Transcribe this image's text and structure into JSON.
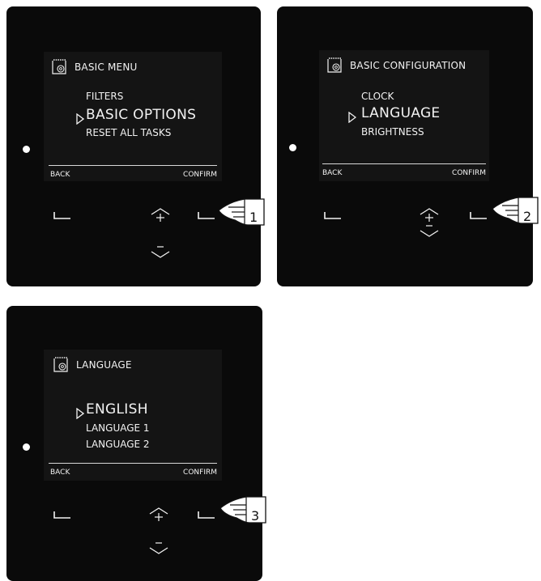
{
  "panels": [
    {
      "title": "BASIC MENU",
      "items": [
        "FILTERS",
        "BASIC OPTIONS",
        "RESET ALL TASKS"
      ],
      "selected_index": 1,
      "back_label": "BACK",
      "confirm_label": "CONFIRM",
      "step_label": "1"
    },
    {
      "title": "BASIC CONFIGURATION",
      "items": [
        "CLOCK",
        "LANGUAGE",
        "BRIGHTNESS"
      ],
      "selected_index": 1,
      "back_label": "BACK",
      "confirm_label": "CONFIRM",
      "step_label": "2"
    },
    {
      "title": "LANGUAGE",
      "items": [
        "ENGLISH",
        "LANGUAGE 1",
        "LANGUAGE 2"
      ],
      "selected_index": 0,
      "back_label": "BACK",
      "confirm_label": "CONFIRM",
      "step_label": "3"
    }
  ],
  "colors": {
    "panel": "#0a0a0a",
    "screen": "#141414",
    "text": "#f2f2f2"
  },
  "icons": {
    "menu": "calendar-gear-icon",
    "up": "up-plus-icon",
    "down": "down-minus-icon"
  }
}
